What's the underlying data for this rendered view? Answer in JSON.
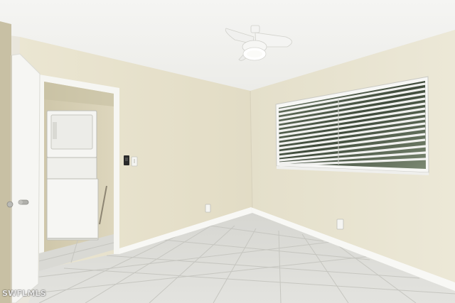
{
  "watermark": {
    "text": "SWFLMLS"
  },
  "colors": {
    "ceiling": "#f2f2f0",
    "wall_left": "#e7e2cd",
    "wall_right": "#e9e5d3",
    "floor_tile": "#dcdcd8",
    "grout": "#c9c9c4",
    "baseboard": "#f7f7f4",
    "door": "#f6f6f3",
    "laundry_wall": "#d5ceb4",
    "washer_dryer": "#f4f4f1",
    "blinds": "#eeeff0",
    "window_glass": "#4c5b47"
  },
  "icons": {
    "ceiling_fan": "ceiling-fan-icon",
    "thermostat": "thermostat-icon",
    "light_switch": "light-switch-icon",
    "outlet": "outlet-icon",
    "door_handle": "door-handle-icon"
  }
}
